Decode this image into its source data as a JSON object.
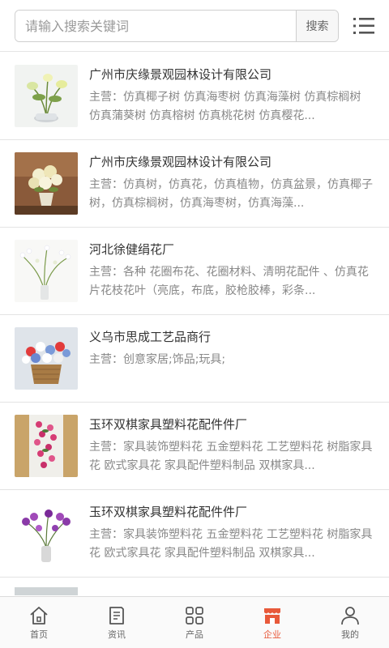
{
  "search": {
    "placeholder": "请输入搜索关键词",
    "button_label": "搜索"
  },
  "menu": {
    "icon": "list-menu-icon"
  },
  "companies": [
    {
      "name": "广州市庆缘景观园林设计有限公司",
      "desc": "主营：仿真椰子树 仿真海枣树 仿真海藻树 仿真棕榈树 仿真蒲葵树 仿真榕树 仿真桃花树 仿真樱花..."
    },
    {
      "name": "广州市庆缘景观园林设计有限公司",
      "desc": "主营：仿真树，仿真花，仿真植物，仿真盆景，仿真椰子树，仿真棕榈树，仿真海枣树，仿真海藻..."
    },
    {
      "name": "河北徐健绢花厂",
      "desc": "主营：各种 花圈布花、花圈材料、清明花配件 、仿真花片花枝花叶（亮底，布底，胶枪胶棒，彩条..."
    },
    {
      "name": "义乌市思成工艺品商行",
      "desc": "主营：创意家居;饰品;玩具;"
    },
    {
      "name": "玉环双棋家具塑料花配件件厂",
      "desc": "主营：家具装饰塑料花 五金塑料花 工艺塑料花 树脂家具花 欧式家具花 家具配件塑料制品 双棋家具..."
    },
    {
      "name": "玉环双棋家具塑料花配件件厂",
      "desc": "主营：家具装饰塑料花 五金塑料花 工艺塑料花 树脂家具花 欧式家具花 家具配件塑料制品 双棋家具..."
    }
  ],
  "tabs": [
    {
      "label": "首页",
      "icon": "home-icon"
    },
    {
      "label": "资讯",
      "icon": "news-icon"
    },
    {
      "label": "产品",
      "icon": "grid-icon"
    },
    {
      "label": "企业",
      "icon": "store-icon",
      "active": true
    },
    {
      "label": "我的",
      "icon": "user-icon"
    }
  ],
  "colors": {
    "accent": "#e8593a",
    "text": "#333333",
    "muted": "#888888"
  }
}
